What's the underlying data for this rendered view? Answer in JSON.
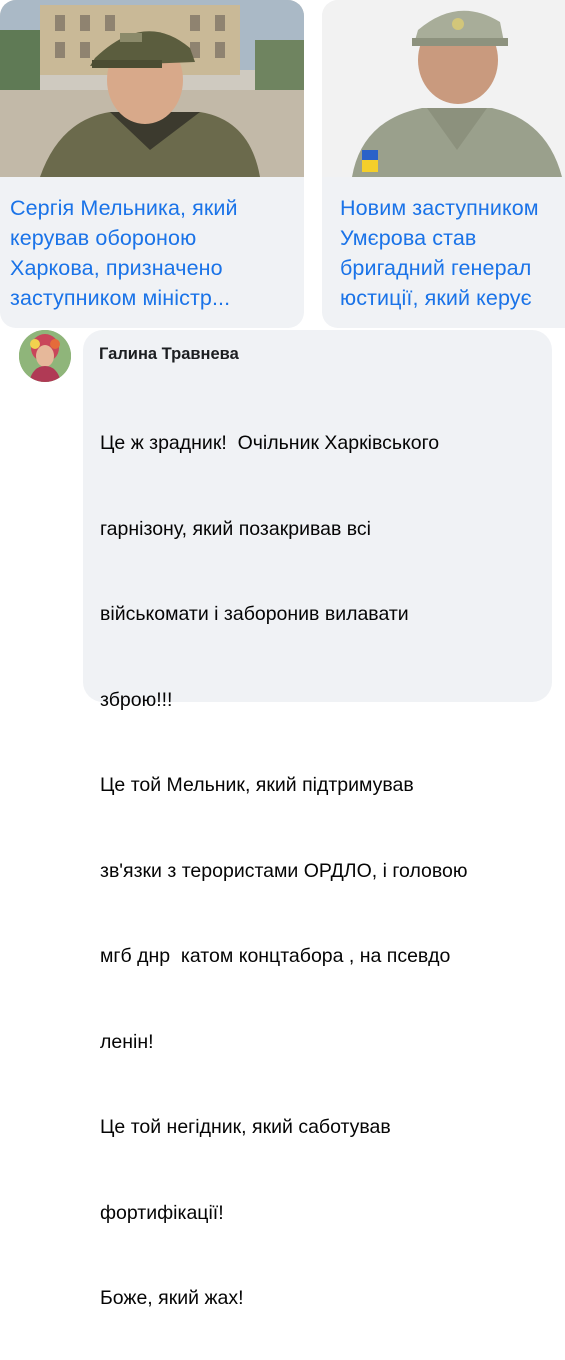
{
  "cards": [
    {
      "image": "photo-soldier-beret",
      "title_lines": [
        "Сергія Мельника, який",
        "керував обороною",
        "Харкова, призначено",
        "заступником міністр..."
      ]
    },
    {
      "image": "photo-officer-cap",
      "title_lines": [
        "Новим заступником",
        "Умєрова став",
        "бригадний генерал",
        "юстиції, який керує"
      ]
    }
  ],
  "comment": {
    "author": "Галина Травнева",
    "avatar": "avatar-photo",
    "lines": [
      "Це ж зрадник!  Очільник Харківського",
      "гарнізону, який позакривав всі",
      "військомати і заборонив вилавати",
      "зброю!!!",
      "Це той Мельник, який підтримував",
      "зв'язки з терористами ОРДЛО, і головою",
      "мгб днр  катом концтабора , на псевдо",
      "ленін!",
      "Це той негідник, який саботував",
      "фортифікації!",
      "Боже, який жах!"
    ]
  },
  "colors": {
    "link": "#1a73e8",
    "bubble": "#f0f2f5",
    "text": "#050505"
  }
}
